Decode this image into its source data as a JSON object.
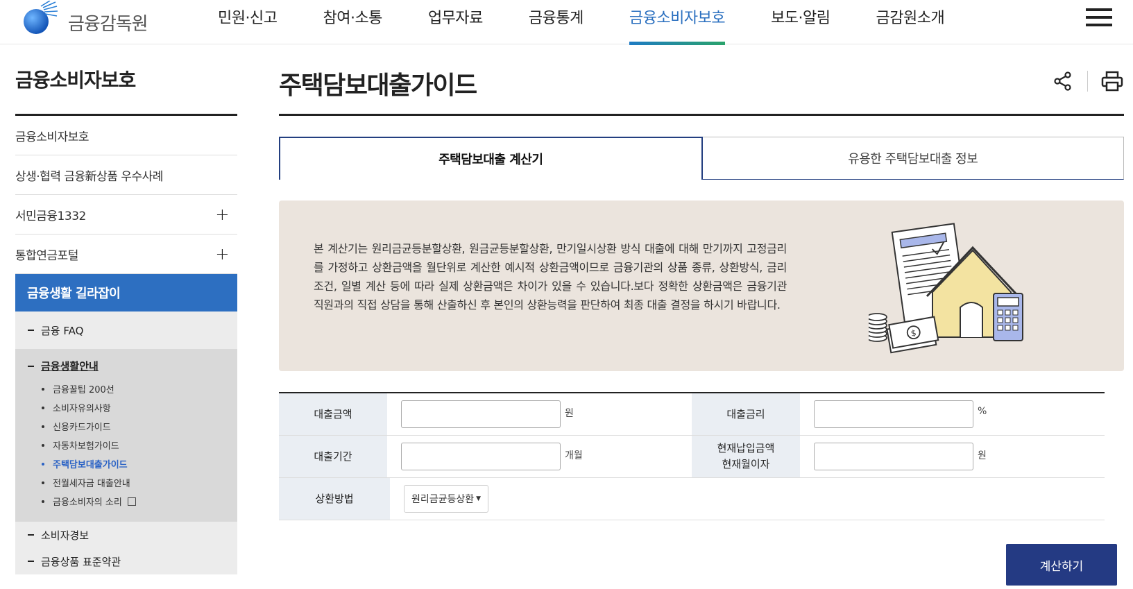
{
  "header": {
    "logo_text": "금융감독원",
    "nav": [
      "민원·신고",
      "참여·소통",
      "업무자료",
      "금융통계",
      "금융소비자보호",
      "보도·알림",
      "금감원소개"
    ],
    "active_index": 4
  },
  "sidebar": {
    "title": "금융소비자보호",
    "items": [
      {
        "label": "금융소비자보호",
        "expandable": false
      },
      {
        "label": "상생·협력 금융新상품 우수사례",
        "expandable": false
      },
      {
        "label": "서민금융1332",
        "expandable": true
      },
      {
        "label": "통합연금포털",
        "expandable": true
      }
    ],
    "expand_symbol": "+",
    "active_section": "금융생활 길라잡이",
    "sub_items": {
      "faq": "금융 FAQ",
      "guide_title": "금융생활안내",
      "guide_list": [
        "금융꿀팁 200선",
        "소비자유의사항",
        "신용카드가이드",
        "자동차보험가이드",
        "주택담보대출가이드",
        "전월세자금 대출안내",
        "금융소비자의 소리"
      ],
      "current_guide_index": 4,
      "alert": "소비자경보",
      "terms": "금융상품 표준약관"
    }
  },
  "main": {
    "title": "주택담보대출가이드",
    "tabs": [
      "주택담보대출 계산기",
      "유용한 주택담보대출 정보"
    ],
    "active_tab": 0,
    "info_text": "본 계산기는 원리금균등분할상환, 원금균등분할상환, 만기일시상환 방식 대출에 대해 만기까지 고정금리를 가정하고 상환금액을 월단위로 계산한 예시적 상환금액이므로 금융기관의 상품 종류, 상환방식, 금리조건, 일별 계산 등에 따라 실제 상환금액은 차이가 있을 수 있습니다.보다 정확한 상환금액은 금융기관 직원과의 직접 상담을 통해 산출하신 후 본인의 상환능력을 판단하여 최종 대출 결정을 하시기 바랍니다.",
    "form": {
      "loan_amount_label": "대출금액",
      "loan_amount_unit": "원",
      "loan_amount_value": "",
      "rate_label": "대출금리",
      "rate_unit": "%",
      "rate_value": "",
      "period_label": "대출기간",
      "period_unit": "개월",
      "period_value": "",
      "current_label_1": "현재납입금액",
      "current_label_2": "현재월이자",
      "current_unit": "원",
      "current_value": "",
      "method_label": "상환방법",
      "method_selected": "원리금균등상환"
    },
    "calc_button": "계산하기"
  },
  "icons": [
    "share-icon",
    "print-icon",
    "menu-icon",
    "external-link-icon",
    "plus-icon"
  ],
  "colors": {
    "brand_blue": "#2d6fc1",
    "navy": "#243a83",
    "info_bg": "#ebe4dd",
    "form_header_bg": "#eaeef3"
  }
}
